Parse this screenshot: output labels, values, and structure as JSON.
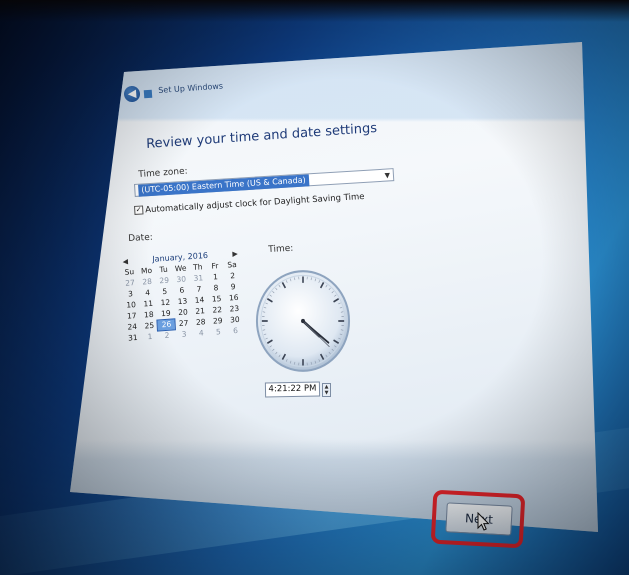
{
  "window": {
    "title": "Set Up Windows",
    "back_glyph": "◀"
  },
  "page": {
    "heading": "Review your time and date settings"
  },
  "timezone": {
    "label": "Time zone:",
    "value": "(UTC-05:00) Eastern Time (US & Canada)",
    "dropdown_glyph": "▼"
  },
  "dst": {
    "checked": true,
    "check_glyph": "✓",
    "label": "Automatically adjust clock for Daylight Saving Time"
  },
  "date": {
    "label": "Date:",
    "month_year": "January, 2016",
    "prev_glyph": "◀",
    "next_glyph": "▶",
    "weekdays": [
      "Su",
      "Mo",
      "Tu",
      "We",
      "Th",
      "Fr",
      "Sa"
    ],
    "weeks": [
      [
        "27",
        "28",
        "29",
        "30",
        "31",
        "1",
        "2"
      ],
      [
        "3",
        "4",
        "5",
        "6",
        "7",
        "8",
        "9"
      ],
      [
        "10",
        "11",
        "12",
        "13",
        "14",
        "15",
        "16"
      ],
      [
        "17",
        "18",
        "19",
        "20",
        "21",
        "22",
        "23"
      ],
      [
        "24",
        "25",
        "26",
        "27",
        "28",
        "29",
        "30"
      ],
      [
        "31",
        "1",
        "2",
        "3",
        "4",
        "5",
        "6"
      ]
    ],
    "selected_day": "26"
  },
  "time": {
    "label": "Time:",
    "value": "4:21:22 PM",
    "hour": 4,
    "minute": 21,
    "second": 22,
    "spinner_up": "▲",
    "spinner_down": "▼"
  },
  "actions": {
    "next_label": "Next"
  },
  "colors": {
    "highlight": "#e3242b",
    "heading": "#1f3b78",
    "selection": "#3a74c8"
  }
}
